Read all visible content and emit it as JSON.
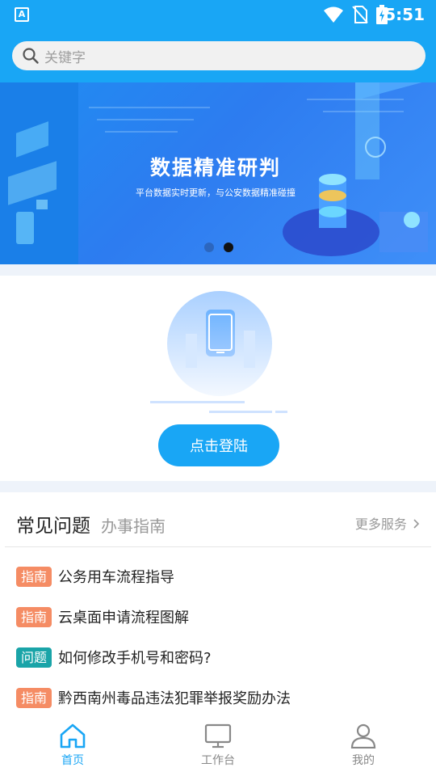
{
  "status_bar": {
    "app_badge": "A",
    "time": "5:51"
  },
  "search": {
    "placeholder": "关键字"
  },
  "banner": {
    "title": "数据精准研判",
    "subtitle": "平台数据实时更新，与公安数据精准碰撞",
    "dots": 2,
    "active_dot": 2
  },
  "login": {
    "button_label": "点击登陆"
  },
  "faq": {
    "tabs": [
      {
        "label": "常见问题",
        "active": true
      },
      {
        "label": "办事指南",
        "active": false
      }
    ],
    "more_label": "更多服务",
    "items": [
      {
        "tag": "指南",
        "tag_color": "#f58c64",
        "text": "公务用车流程指导"
      },
      {
        "tag": "指南",
        "tag_color": "#f58c64",
        "text": "云桌面申请流程图解"
      },
      {
        "tag": "问题",
        "tag_color": "#1aa4a8",
        "text": "如何修改手机号和密码?"
      },
      {
        "tag": "指南",
        "tag_color": "#f58c64",
        "text": "黔西南州毒品违法犯罪举报奖励办法"
      }
    ]
  },
  "bottom_nav": [
    {
      "label": "首页",
      "icon": "home-icon",
      "active": true
    },
    {
      "label": "工作台",
      "icon": "monitor-icon",
      "active": false
    },
    {
      "label": "我的",
      "icon": "user-icon",
      "active": false
    }
  ],
  "colors": {
    "primary": "#19a6f5",
    "guide_tag": "#f58c64",
    "question_tag": "#1aa4a8"
  }
}
